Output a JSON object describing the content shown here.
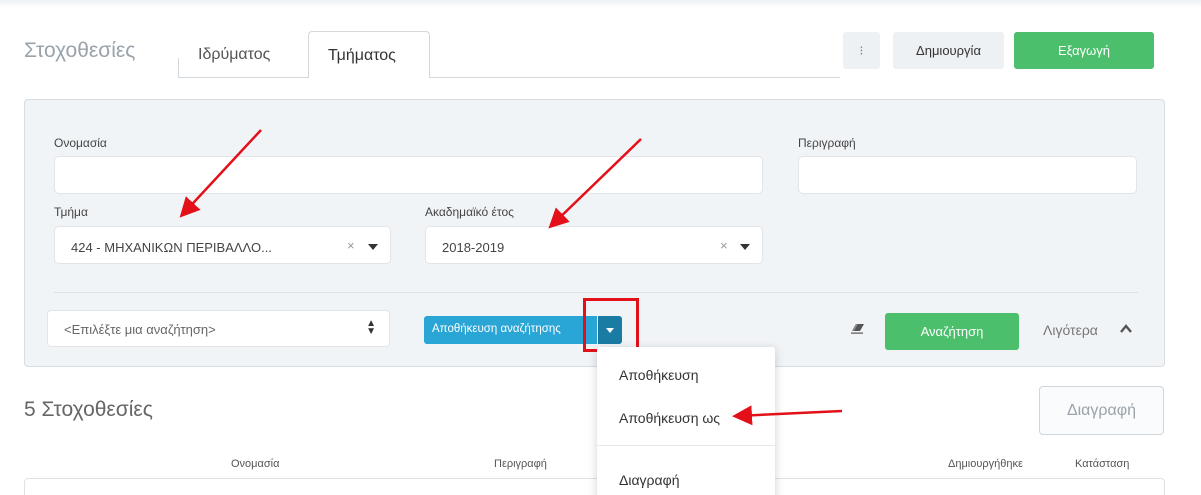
{
  "header": {
    "title": "Στοχοθεσίες",
    "tabs": [
      {
        "label": "Ιδρύματος",
        "active": false
      },
      {
        "label": "Τμήματος",
        "active": true
      }
    ],
    "kebab_glyph": "⁝",
    "create_label": "Δημιουργία",
    "export_label": "Εξαγωγή"
  },
  "filters": {
    "name_label": "Ονομασία",
    "name_value": "",
    "description_label": "Περιγραφή",
    "description_value": "",
    "department_label": "Τμήμα",
    "department_value": "424 - ΜΗΧΑΝΙΚΩΝ ΠΕΡΙΒΑΛΛΟ...",
    "year_label": "Ακαδημαϊκό έτος",
    "year_value": "2018-2019",
    "clear_glyph": "×"
  },
  "search_bar": {
    "saved_search_placeholder": "<Επιλέξτε μια αναζήτηση>",
    "save_search_label": "Αποθήκευση αναζήτησης",
    "search_label": "Αναζήτηση",
    "less_label": "Λιγότερα"
  },
  "dropdown_menu": {
    "items": [
      "Αποθήκευση",
      "Αποθήκευση ως",
      "Διαγραφή"
    ]
  },
  "results": {
    "title": "5 Στοχοθεσίες",
    "delete_label": "Διαγραφή",
    "columns": [
      "Ονομασία",
      "Περιγραφή",
      "Δημιουργήθηκε",
      "Κατάσταση"
    ]
  },
  "colors": {
    "accent_green": "#4bbf6b",
    "accent_blue": "#2aa6d6",
    "annotation_red": "#e3101a"
  },
  "icons": [
    "kebab-menu-icon",
    "clear-x-icon",
    "caret-down-icon",
    "sort-updown-icon",
    "eraser-icon",
    "chevron-up-icon",
    "red-arrow-annotation"
  ]
}
